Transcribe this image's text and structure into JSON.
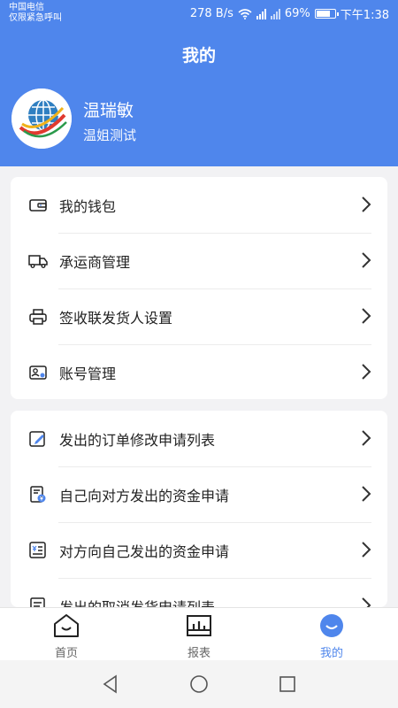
{
  "status_bar": {
    "carrier": "中国电信",
    "emergency": "仅限紧急呼叫",
    "speed": "278 B/s",
    "battery": "69%",
    "time": "下午1:38"
  },
  "header": {
    "title": "我的",
    "user_name": "温瑞敏",
    "user_subtitle": "温姐测试"
  },
  "menu_group_1": [
    {
      "label": "我的钱包",
      "icon": "wallet-icon"
    },
    {
      "label": "承运商管理",
      "icon": "truck-icon"
    },
    {
      "label": "签收联发货人设置",
      "icon": "printer-icon"
    },
    {
      "label": "账号管理",
      "icon": "account-card-icon"
    }
  ],
  "menu_group_2": [
    {
      "label": "发出的订单修改申请列表",
      "icon": "edit-icon"
    },
    {
      "label": "自己向对方发出的资金申请",
      "icon": "document-yen-icon"
    },
    {
      "label": "对方向自己发出的资金申请",
      "icon": "list-yen-icon"
    },
    {
      "label": "发出的取消发货申请列表",
      "icon": "document-icon"
    }
  ],
  "tabbar": [
    {
      "label": "首页",
      "icon": "home-icon",
      "active": false
    },
    {
      "label": "报表",
      "icon": "report-icon",
      "active": false
    },
    {
      "label": "我的",
      "icon": "profile-icon",
      "active": true
    }
  ],
  "colors": {
    "primary": "#4f86ec",
    "background": "#f2f2f4",
    "text": "#222222"
  }
}
